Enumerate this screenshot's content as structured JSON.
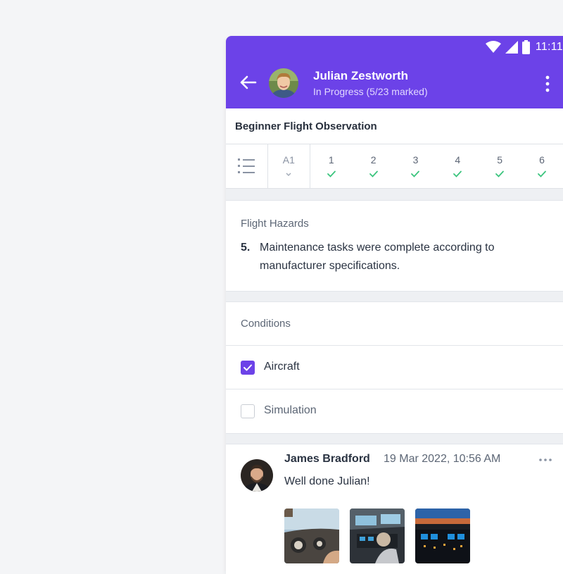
{
  "status_bar": {
    "time": "11:11",
    "icons": [
      "wifi-icon",
      "signal-icon",
      "battery-icon"
    ]
  },
  "header": {
    "name": "Julian Zestworth",
    "subtitle": "In Progress (5/23 marked)",
    "accent": "#6c42e8"
  },
  "form": {
    "title": "Beginner Flight Observation"
  },
  "tabs": {
    "list_icon": "list-icon",
    "section": "A1",
    "items": [
      {
        "label": "1",
        "done": true
      },
      {
        "label": "2",
        "done": true
      },
      {
        "label": "3",
        "done": true
      },
      {
        "label": "4",
        "done": true
      },
      {
        "label": "5",
        "done": true
      },
      {
        "label": "6",
        "done": true
      }
    ],
    "check_color": "#3ac47d"
  },
  "question": {
    "section": "Flight Hazards",
    "number": "5.",
    "line1": "Maintenance tasks were complete according to",
    "line2": "manufacturer specifications."
  },
  "conditions": {
    "label": "Conditions",
    "options": [
      {
        "label": "Aircraft",
        "checked": true
      },
      {
        "label": "Simulation",
        "checked": false
      }
    ]
  },
  "comment": {
    "author": "James Bradford",
    "timestamp": "19 Mar 2022, 10:56 AM",
    "text": "Well done Julian!",
    "more_icon": "more-horizontal-icon",
    "attachments": [
      "cockpit-photo-1",
      "cockpit-photo-2",
      "cockpit-photo-3"
    ]
  }
}
